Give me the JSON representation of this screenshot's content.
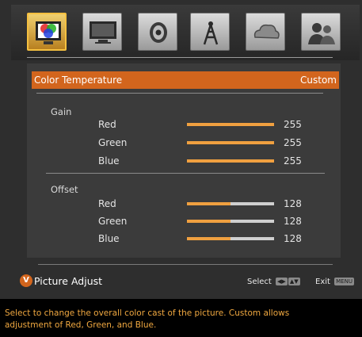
{
  "menu": {
    "icons": [
      {
        "name": "picture-icon",
        "active": true
      },
      {
        "name": "screen-icon",
        "active": false
      },
      {
        "name": "audio-icon",
        "active": false
      },
      {
        "name": "tuner-icon",
        "active": false
      },
      {
        "name": "network-icon",
        "active": false
      },
      {
        "name": "user-icon",
        "active": false
      }
    ]
  },
  "selected": {
    "label": "Color Temperature",
    "value": "Custom"
  },
  "gain": {
    "label": "Gain",
    "items": [
      {
        "label": "Red",
        "value": "255",
        "level": 1.0
      },
      {
        "label": "Green",
        "value": "255",
        "level": 1.0
      },
      {
        "label": "Blue",
        "value": "255",
        "level": 1.0
      }
    ]
  },
  "offset": {
    "label": "Offset",
    "items": [
      {
        "label": "Red",
        "value": "128",
        "level": 0.5
      },
      {
        "label": "Green",
        "value": "128",
        "level": 0.5
      },
      {
        "label": "Blue",
        "value": "128",
        "level": 0.5
      }
    ]
  },
  "footer": {
    "logo_letter": "V",
    "title": "Picture Adjust",
    "select_label": "Select",
    "exit_label": "Exit",
    "menu_key": "MENU"
  },
  "help_text": "Select to change the overall color cast of the picture. Custom allows adjustment of Red, Green, and Blue.",
  "colors": {
    "accent": "#d2651d",
    "bar_fill": "#f0a040",
    "help_text": "#f0a840"
  }
}
